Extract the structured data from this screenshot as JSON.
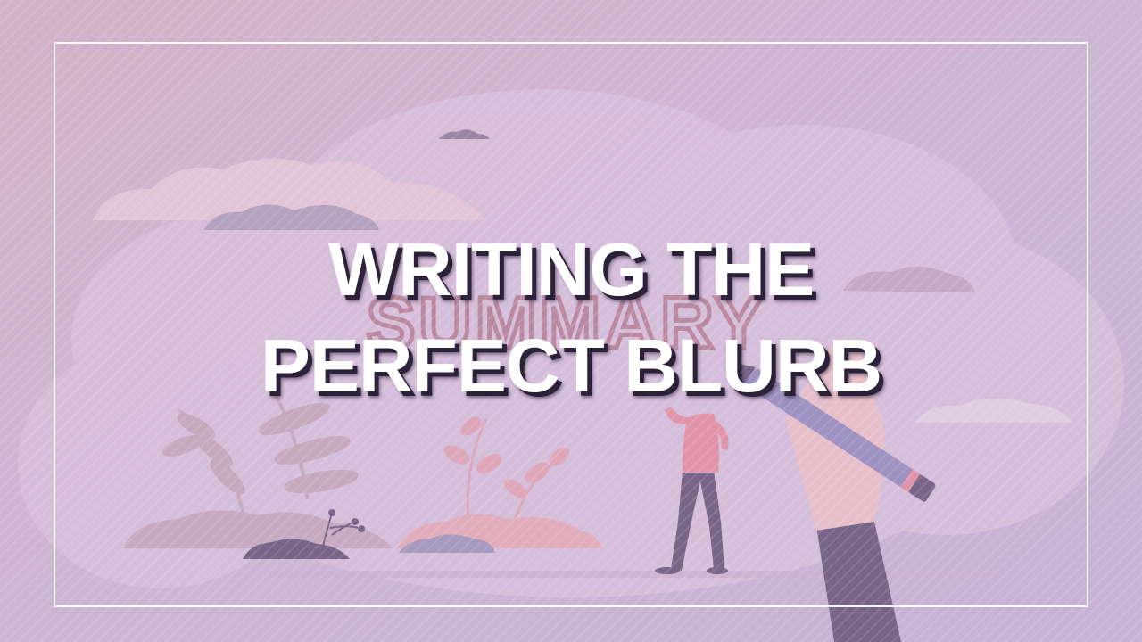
{
  "headline": {
    "line1": "WRITING THE",
    "line2": "PERFECT BLURB"
  },
  "illustration": {
    "word": "SUMMARY",
    "icons": [
      "pencil-icon",
      "hand-icon",
      "person-figure",
      "plant-icon",
      "cloud-icon"
    ]
  },
  "colors": {
    "background": "#cdb6d3",
    "cloud": "#dcc4de",
    "summary_text": "#b4788f",
    "pink": "#e5a6b6",
    "dark_purple": "#5c4a6f",
    "pencil": "#8f86bd",
    "headline": "#ffffff",
    "headline_shadow": "#2b2138"
  }
}
